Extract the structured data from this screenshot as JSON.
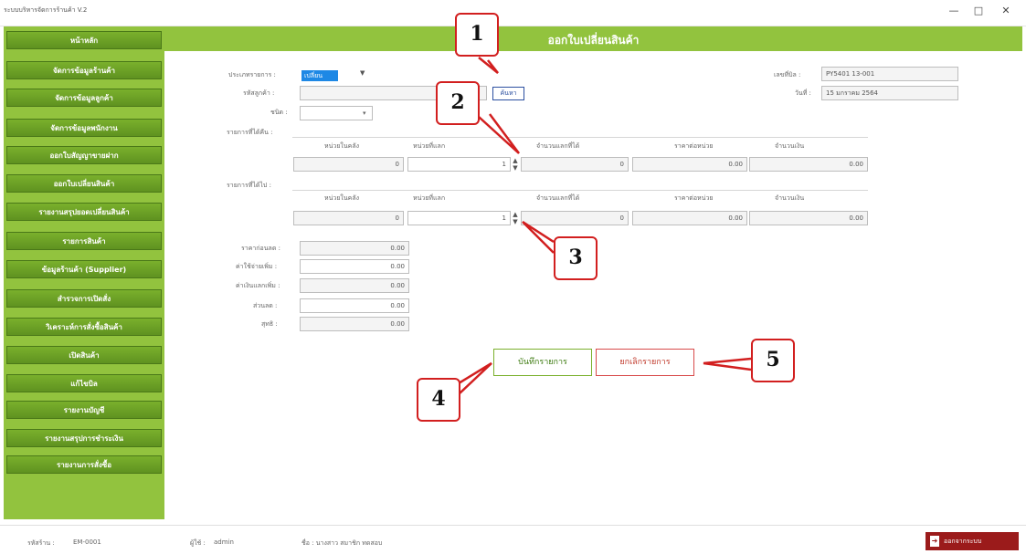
{
  "window": {
    "title": "ระบบบริหารจัดการร้านค้า V.2",
    "minimize": "—",
    "maximize": "□",
    "close": "✕"
  },
  "sidebar": {
    "items": [
      {
        "label": "หน้าหลัก"
      },
      {
        "label": "จัดการข้อมูลร้านค้า"
      },
      {
        "label": "จัดการข้อมูลลูกค้า"
      },
      {
        "label": "จัดการข้อมูลพนักงาน"
      },
      {
        "label": "ออกใบสัญญาขายฝาก"
      },
      {
        "label": "ออกใบเปลี่ยนสินค้า"
      },
      {
        "label": "รายงานสรุปยอดเปลี่ยนสินค้า"
      },
      {
        "label": "รายการสินค้า"
      },
      {
        "label": "ข้อมูลร้านค้า (Supplier)"
      },
      {
        "label": "สำรวจการเปิดสั่ง"
      },
      {
        "label": "วิเคราะห์การสั่งซื้อสินค้า"
      },
      {
        "label": "เปิดสินค้า"
      },
      {
        "label": "แก้ไขบิล"
      },
      {
        "label": "รายงานบัญชี"
      },
      {
        "label": "รายงานสรุปการชำระเงิน"
      },
      {
        "label": "รายงานการสั่งซื้อ"
      }
    ]
  },
  "header": {
    "title": "ออกใบเปลี่ยนสินค้า"
  },
  "form": {
    "transaction_type_label": "ประเภทรายการ :",
    "transaction_type_value": "เปลี่ยน",
    "customer_label": "รหัสลูกค้า :",
    "customer_value": "",
    "search_button": "ค้นหา",
    "type_label": "ชนิด :",
    "type_value": "",
    "doc_no_label": "เลขที่บิล :",
    "doc_no_value": "PY5401 13-001",
    "date_label": "วันที่ :",
    "date_value": "15 มกราคม 2564",
    "return_section_label": "รายการที่ได้คืน :",
    "receive_section_label": "รายการที่ได้ไป :",
    "columns": [
      "หน่วยในคลัง",
      "หน่วยที่แลก",
      "จำนวนแลกที่ได้",
      "ราคาต่อหน่วย",
      "จำนวนเงิน"
    ],
    "return_row": {
      "stock": "0",
      "qty": "1",
      "exchange": "0",
      "unit_price": "0.00",
      "amount": "0.00"
    },
    "receive_row": {
      "stock": "0",
      "qty": "1",
      "exchange": "0",
      "unit_price": "0.00",
      "amount": "0.00"
    },
    "summary": [
      {
        "label": "ราคาก่อนลด :",
        "value": "0.00"
      },
      {
        "label": "ค่าใช้จ่ายเพิ่ม :",
        "value": "0.00"
      },
      {
        "label": "ค่าเงินแลกเพิ่ม :",
        "value": "0.00"
      },
      {
        "label": "ส่วนลด :",
        "value": "0.00"
      },
      {
        "label": "สุทธิ :",
        "value": "0.00"
      }
    ]
  },
  "actions": {
    "save": "บันทึกรายการ",
    "cancel": "ยกเลิกรายการ"
  },
  "callouts": [
    "1",
    "2",
    "3",
    "4",
    "5"
  ],
  "status": {
    "branch_label": "รหัสร้าน :",
    "branch_value": "EM-0001",
    "user_label": "ผู้ใช้ :",
    "user_value": "admin",
    "name_text": "ชื่อ : นางสาว  สมาชิก ทดสอบ",
    "logout": "ออกจากระบบ"
  },
  "colors": {
    "accent": "#92c33e",
    "callout": "#d21f1f",
    "logout": "#9b1b1b"
  }
}
